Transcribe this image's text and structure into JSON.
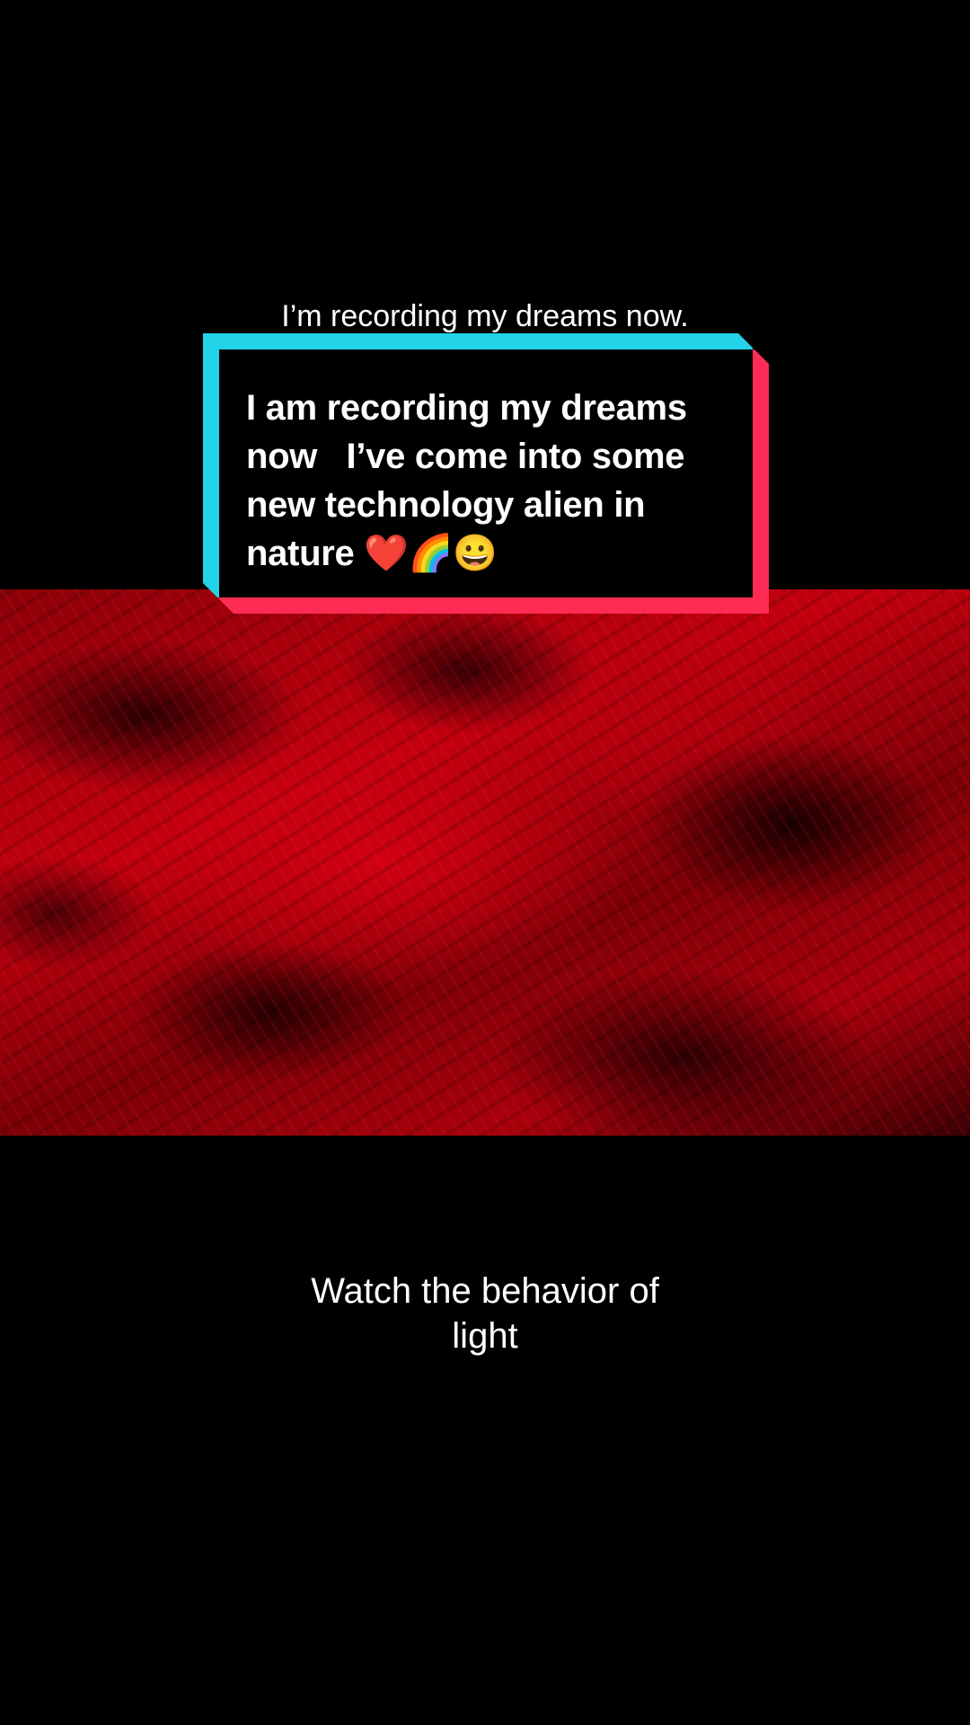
{
  "top_caption": "I’m recording my dreams now.",
  "comment_card": {
    "text": "I am recording my dreams now   I’ve come into some new technology alien in nature ❤️🌈😀",
    "frame_colors": {
      "cyan": "#25d3e8",
      "pink": "#fe2c55"
    }
  },
  "video": {
    "dominant_color": "#c2000f"
  },
  "bottom_caption": {
    "line1": "Watch the behavior of",
    "line2": "light"
  }
}
